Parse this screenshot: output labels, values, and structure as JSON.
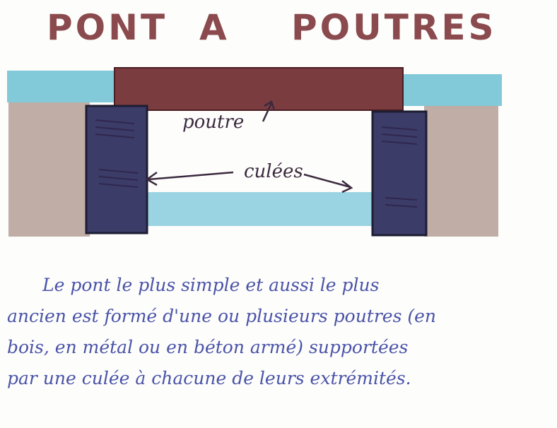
{
  "title": {
    "word1": "PONT",
    "word2": "A",
    "word3": "POUTRES"
  },
  "labels": {
    "beam": "poutre",
    "abutments": "culées"
  },
  "description": {
    "line1": "Le pont le plus simple et aussi le plus",
    "line2": "ancien est formé d'une ou plusieurs poutres (en",
    "line3": "bois, en métal ou en béton armé) supportées",
    "line4": "par une culée à chacune de leurs extrémités."
  },
  "colors": {
    "title": "#8a4a4e",
    "beam": "#7a3d3f",
    "abutment": "#3f3f6a",
    "water": "#7cc6d8",
    "ground": "#b8a39a",
    "text": "#4a53a8"
  }
}
